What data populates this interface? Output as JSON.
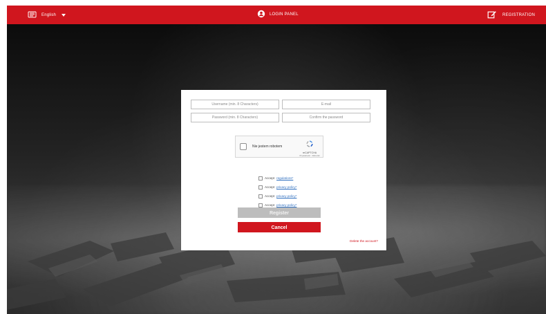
{
  "colors": {
    "brand_red": "#d0161e",
    "link_blue": "#2f6fbf",
    "disabled_gray": "#bdbdbd"
  },
  "header": {
    "language": {
      "label": "English",
      "icon": "language-flag-icon",
      "dropdown_icon": "caret-down-icon"
    },
    "login_panel": {
      "label": "LOGIN PANEL",
      "icon": "user-circle-icon"
    },
    "registration": {
      "label": "REGISTRATION",
      "icon": "edit-icon"
    }
  },
  "form": {
    "username_placeholder": "Username (min. 8 Characters)",
    "email_placeholder": "E-mail",
    "password_placeholder": "Password (min. 8 Characters)",
    "confirm_password_placeholder": "Confirm the password",
    "recaptcha": {
      "checkbox_label": "Nie jestem robotem",
      "title": "reCAPTCHA",
      "subtext": "Prywatność - Warunki",
      "icon": "recaptcha-icon"
    },
    "accept_items": [
      {
        "prefix": "Accept",
        "link_text": "regulations*"
      },
      {
        "prefix": "Accept",
        "link_text": "privacy policy*"
      },
      {
        "prefix": "Accept",
        "link_text": "privacy policy*"
      },
      {
        "prefix": "Accept",
        "link_text": "privacy policy*"
      }
    ],
    "register_button": "Register",
    "cancel_button": "Cancel",
    "delete_account_link": "Delete the account?"
  }
}
